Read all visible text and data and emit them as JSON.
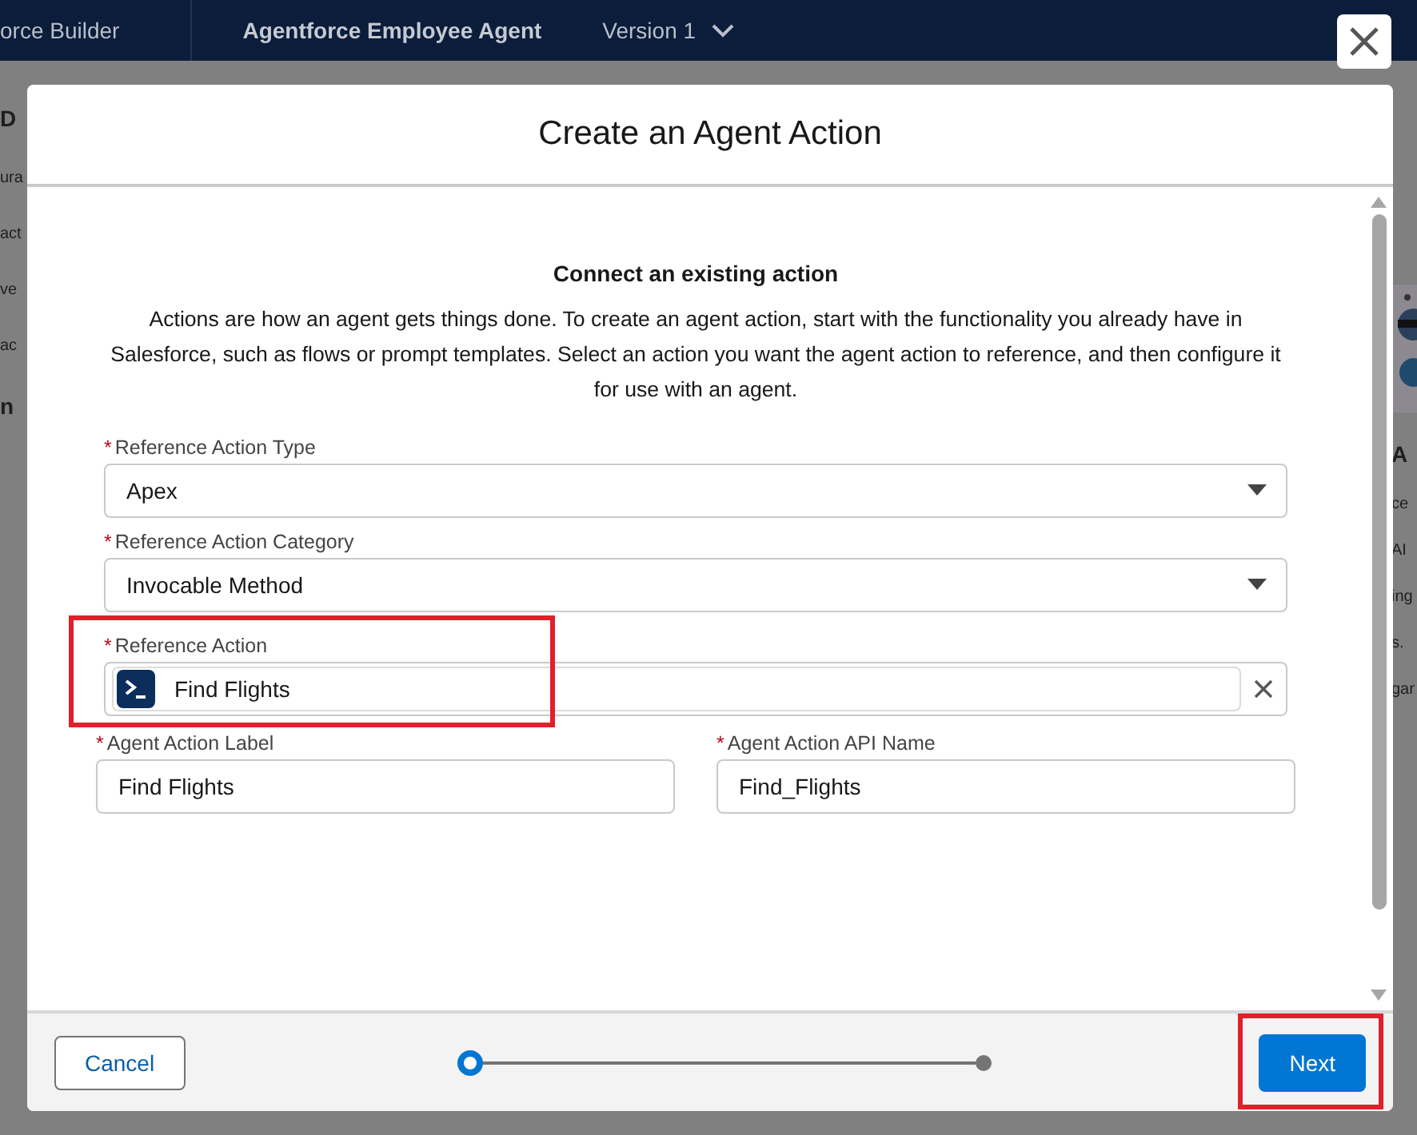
{
  "top_bar": {
    "app_name": "orce Builder",
    "agent_name": "Agentforce Employee Agent",
    "version": "Version 1"
  },
  "background_left": [
    "D",
    "ura",
    "act",
    "ve",
    "ac",
    "n"
  ],
  "background_right": [
    "A",
    "ce",
    "AI",
    "ing",
    "s.",
    "gar"
  ],
  "modal": {
    "title": "Create an Agent Action",
    "section_title": "Connect an existing action",
    "description": "Actions are how an agent gets things done. To create an agent action, start with the functionality you already have in Salesforce, such as flows or prompt templates. Select an action you want the agent action to reference, and then configure it for use with an agent.",
    "fields": [
      {
        "kind": "select",
        "label": "Reference Action Type",
        "required_mark": "*",
        "value": "Apex"
      },
      {
        "kind": "select",
        "label": "Reference Action Category",
        "required_mark": "*",
        "value": "Invocable Method"
      },
      {
        "kind": "lookup",
        "label": "Reference Action",
        "required_mark": "*",
        "value": "Find Flights",
        "highlighted": true
      }
    ],
    "text_fields": [
      {
        "label": "Agent Action Label",
        "required_mark": "*",
        "value": "Find Flights"
      },
      {
        "label": "Agent Action API Name",
        "required_mark": "*",
        "value": "Find_Flights"
      }
    ],
    "steps": [
      {
        "selected": true
      },
      {
        "selected": false
      }
    ],
    "buttons": {
      "cancel": "Cancel",
      "next": "Next",
      "next_highlighted": true
    }
  }
}
